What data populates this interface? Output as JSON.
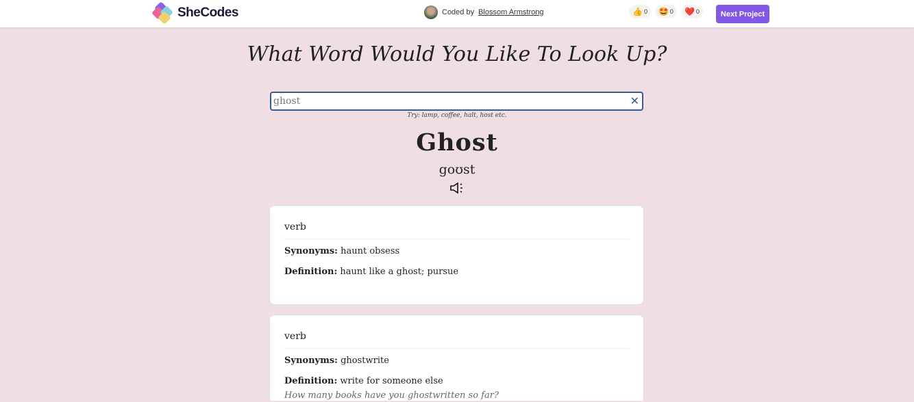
{
  "header": {
    "brand": "SheCodes",
    "coded_by": "Coded by",
    "author": "Blossom Armstrong",
    "reactions": [
      {
        "icon": "thumbs-up-icon",
        "emoji": "👍",
        "count": "0"
      },
      {
        "icon": "star-eyes-icon",
        "emoji": "🤩",
        "count": "0"
      },
      {
        "icon": "heart-icon",
        "emoji": "❤️",
        "count": "0"
      }
    ],
    "next_label": "Next Project",
    "accent": "#8358e8"
  },
  "main": {
    "title": "What Word Would You Like To Look Up?",
    "search_value": "ghost",
    "clear": "✕",
    "hint": "Try: lamp, coffee, halt, host etc.",
    "word": "Ghost",
    "phonetic": "goʊst"
  },
  "meanings": [
    {
      "pos": "verb",
      "syn_label": "Synonyms:",
      "synonyms": "haunt obsess",
      "def_label": "Definition:",
      "definition": "haunt like a ghost; pursue"
    },
    {
      "pos": "verb",
      "syn_label": "Synonyms:",
      "synonyms": "ghostwrite",
      "def_label": "Definition:",
      "definition": "write for someone else",
      "example": "How many books have you ghostwritten so far?"
    }
  ]
}
